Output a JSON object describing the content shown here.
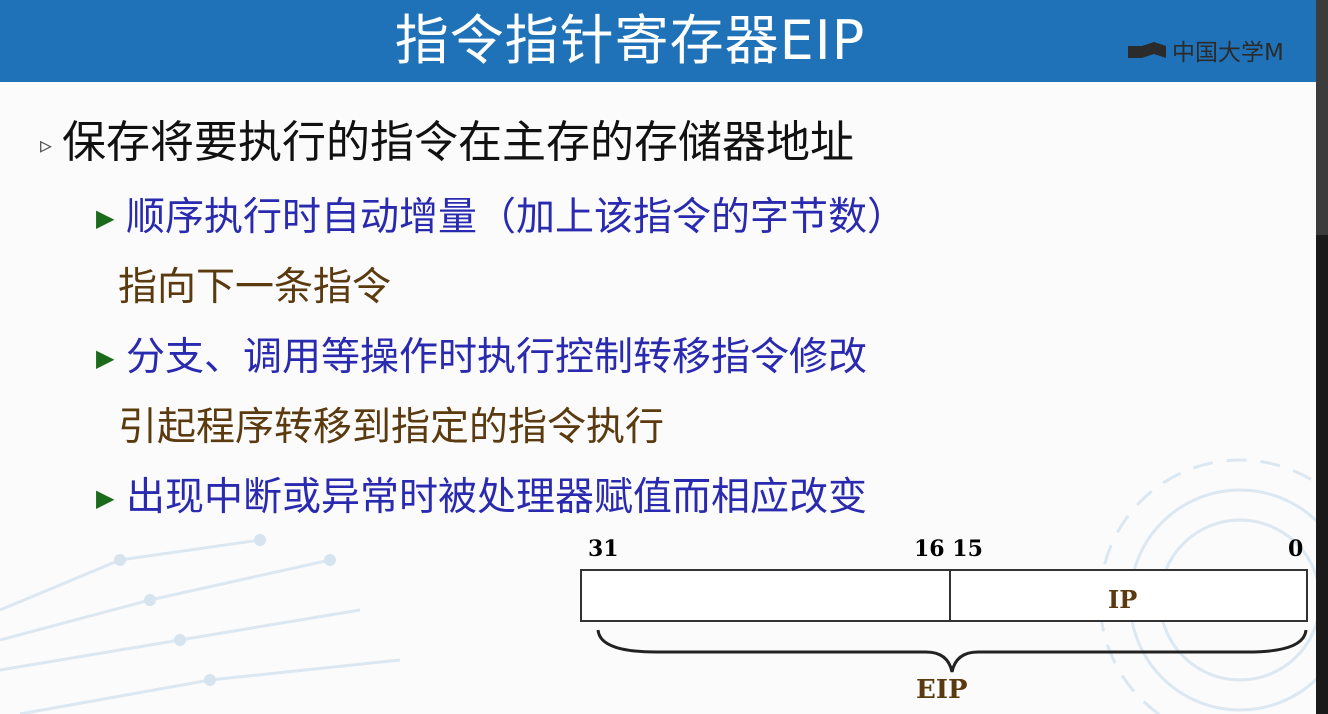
{
  "slide": {
    "title": "指令指针寄存器EIP",
    "watermark": "中国大学M",
    "bullet_main": "保存将要执行的指令在主存的存储器地址",
    "sub_items": [
      {
        "line1": "顺序执行时自动增量（加上该指令的字节数）",
        "line2": "指向下一条指令"
      },
      {
        "line1": "分支、调用等操作时执行控制转移指令修改",
        "line2": "引起程序转移到指定的指令执行"
      },
      {
        "line1": "出现中断或异常时被处理器赋值而相应改变"
      }
    ]
  },
  "register": {
    "bit_31": "31",
    "bit_16_15": "16 15",
    "bit_0": "0",
    "low_label": "IP",
    "full_label": "EIP"
  },
  "icons": {
    "bullet_main": "hollow-triangle-bullet-icon",
    "bullet_sub": "solid-triangle-bullet-icon"
  },
  "colors": {
    "title_bar": "#1f72b8",
    "sub_text": "#2a2ab0",
    "continuation_text": "#5a3a0e"
  }
}
